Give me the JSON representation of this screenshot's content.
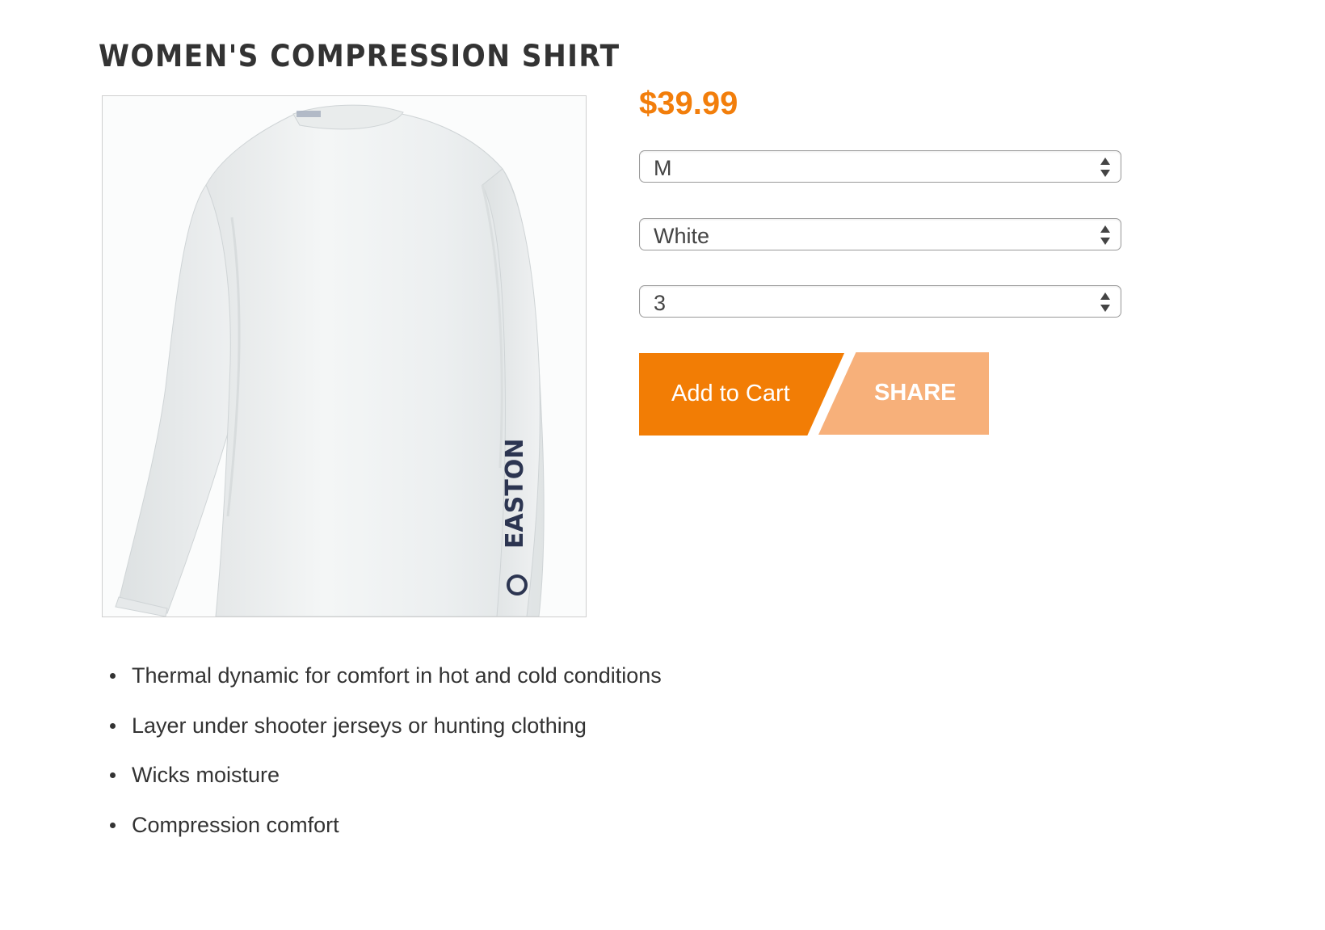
{
  "product": {
    "title": "WOMEN'S COMPRESSION SHIRT",
    "price": "$39.99",
    "image_alt": "White long-sleeve compression shirt",
    "brand_mark": "EASTON"
  },
  "options": {
    "size": {
      "selected": "M"
    },
    "color": {
      "selected": "White"
    },
    "quantity": {
      "selected": "3"
    }
  },
  "actions": {
    "add_to_cart_label": "Add to Cart",
    "share_label": "SHARE"
  },
  "features": [
    "Thermal dynamic for comfort in hot and cold conditions",
    "Layer under shooter jerseys or hunting clothing",
    "Wicks moisture",
    "Compression comfort"
  ],
  "colors": {
    "accent": "#f27d05",
    "accent_light": "#f7b07a",
    "text": "#333333"
  }
}
